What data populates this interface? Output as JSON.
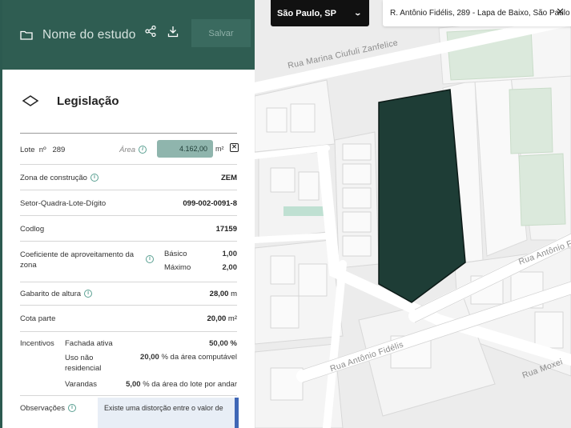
{
  "study": {
    "title": "Nome do estudo",
    "save_label": "Salvar"
  },
  "legislacao": {
    "heading": "Legislação",
    "lote_label": "Lote",
    "lote_no_label": "nº",
    "lote_number": "289",
    "area_label": "Área",
    "area_value": "4.162,00",
    "area_unit": "m²",
    "zona_label": "Zona de construção",
    "zona_value": "ZEM",
    "setor_label": "Setor-Quadra-Lote-Dígito",
    "setor_value": "099-002-0091-8",
    "codlog_label": "Codlog",
    "codlog_value": "17159",
    "coef_label": "Coeficiente de aproveitamento da zona",
    "coef_basico_label": "Básico",
    "coef_basico_value": "1,00",
    "coef_maximo_label": "Máximo",
    "coef_maximo_value": "2,00",
    "gabarito_label": "Gabarito de altura",
    "gabarito_value": "28,00",
    "gabarito_unit": "m",
    "cota_label": "Cota parte",
    "cota_value": "20,00",
    "cota_unit": "m²",
    "incentivos_label": "Incentivos",
    "incentivos": [
      {
        "key": "Fachada ativa",
        "value": "50,00",
        "suffix": "%"
      },
      {
        "key": "Uso não residencial",
        "value": "20,00",
        "suffix": "% da área computável"
      },
      {
        "key": "Varandas",
        "value": "5,00",
        "suffix": "% da área do lote por andar"
      }
    ],
    "observacoes_label": "Observações",
    "observacoes_text": "Existe uma distorção entre o valor de"
  },
  "map": {
    "city": "São Paulo, SP",
    "address": "R. Antônio Fidélis, 289 - Lapa de Baixo, São Paulo",
    "streets": {
      "marina": "Rua Marina Ciufuli Zanfelice",
      "antonio_fidelis_lower": "Rua Antônio Fidélis",
      "antonio_fidelis_right": "Rua Antônio F",
      "moxei": "Rua Moxei"
    },
    "lot_color": "#1e3d36",
    "park_color": "#dbe9dc"
  },
  "colors": {
    "header_bg": "#2f5d52",
    "accent": "#5aa092",
    "area_field_bg": "#8fb5ad"
  }
}
